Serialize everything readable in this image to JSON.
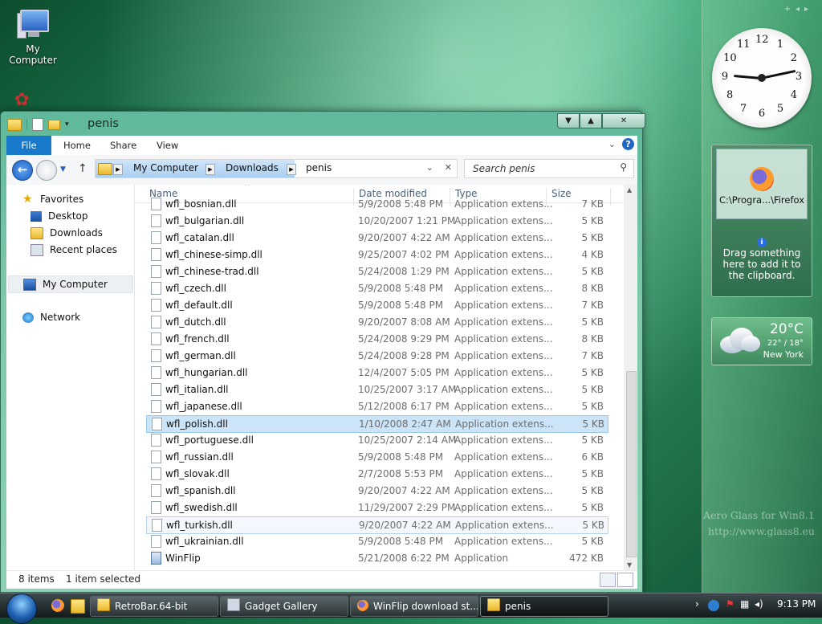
{
  "desktop": {
    "icon_label": "My Computer"
  },
  "clock": {
    "numbers": [
      "12",
      "1",
      "2",
      "3",
      "4",
      "5",
      "6",
      "7",
      "8",
      "9",
      "10",
      "11"
    ]
  },
  "clipboard_gadget": {
    "file_label": "C:\\Progra...\\Firefox",
    "hint": "Drag something here to add it to the clipboard."
  },
  "weather": {
    "temp": "20°C",
    "range": "22° / 18°",
    "city": "New York"
  },
  "watermark": {
    "line1": "Aero Glass for Win8.1",
    "line2": "http://www.glass8.eu"
  },
  "window": {
    "title": "penis",
    "ribbon_tabs": [
      "File",
      "Home",
      "Share",
      "View"
    ],
    "address": {
      "crumbs": [
        "My Computer",
        "Downloads",
        "penis"
      ]
    },
    "search": {
      "placeholder": "Search penis"
    },
    "nav": {
      "favorites": "Favorites",
      "desktop": "Desktop",
      "downloads": "Downloads",
      "recent": "Recent places",
      "my_computer": "My Computer",
      "network": "Network"
    },
    "columns": {
      "name": "Name",
      "date": "Date modified",
      "type": "Type",
      "size": "Size"
    },
    "files": [
      {
        "name": "wfl_bosnian.dll",
        "date": "5/9/2008 5:48 PM",
        "type": "Application extens...",
        "size": "7 KB"
      },
      {
        "name": "wfl_bulgarian.dll",
        "date": "10/20/2007 1:21 PM",
        "type": "Application extens...",
        "size": "5 KB"
      },
      {
        "name": "wfl_catalan.dll",
        "date": "9/20/2007 4:22 AM",
        "type": "Application extens...",
        "size": "5 KB"
      },
      {
        "name": "wfl_chinese-simp.dll",
        "date": "9/25/2007 4:02 PM",
        "type": "Application extens...",
        "size": "4 KB"
      },
      {
        "name": "wfl_chinese-trad.dll",
        "date": "5/24/2008 1:29 PM",
        "type": "Application extens...",
        "size": "5 KB"
      },
      {
        "name": "wfl_czech.dll",
        "date": "5/9/2008 5:48 PM",
        "type": "Application extens...",
        "size": "8 KB"
      },
      {
        "name": "wfl_default.dll",
        "date": "5/9/2008 5:48 PM",
        "type": "Application extens...",
        "size": "7 KB"
      },
      {
        "name": "wfl_dutch.dll",
        "date": "9/20/2007 8:08 AM",
        "type": "Application extens...",
        "size": "5 KB"
      },
      {
        "name": "wfl_french.dll",
        "date": "5/24/2008 9:29 PM",
        "type": "Application extens...",
        "size": "8 KB"
      },
      {
        "name": "wfl_german.dll",
        "date": "5/24/2008 9:28 PM",
        "type": "Application extens...",
        "size": "7 KB"
      },
      {
        "name": "wfl_hungarian.dll",
        "date": "12/4/2007 5:05 PM",
        "type": "Application extens...",
        "size": "5 KB"
      },
      {
        "name": "wfl_italian.dll",
        "date": "10/25/2007 3:17 AM",
        "type": "Application extens...",
        "size": "5 KB"
      },
      {
        "name": "wfl_japanese.dll",
        "date": "5/12/2008 6:17 PM",
        "type": "Application extens...",
        "size": "5 KB"
      },
      {
        "name": "wfl_polish.dll",
        "date": "1/10/2008 2:47 AM",
        "type": "Application extens...",
        "size": "5 KB"
      },
      {
        "name": "wfl_portuguese.dll",
        "date": "10/25/2007 2:14 AM",
        "type": "Application extens...",
        "size": "5 KB"
      },
      {
        "name": "wfl_russian.dll",
        "date": "5/9/2008 5:48 PM",
        "type": "Application extens...",
        "size": "6 KB"
      },
      {
        "name": "wfl_slovak.dll",
        "date": "2/7/2008 5:53 PM",
        "type": "Application extens...",
        "size": "5 KB"
      },
      {
        "name": "wfl_spanish.dll",
        "date": "9/20/2007 4:22 AM",
        "type": "Application extens...",
        "size": "5 KB"
      },
      {
        "name": "wfl_swedish.dll",
        "date": "11/29/2007 2:29 PM",
        "type": "Application extens...",
        "size": "5 KB"
      },
      {
        "name": "wfl_turkish.dll",
        "date": "9/20/2007 4:22 AM",
        "type": "Application extens...",
        "size": "5 KB"
      },
      {
        "name": "wfl_ukrainian.dll",
        "date": "5/9/2008 5:48 PM",
        "type": "Application extens...",
        "size": "5 KB"
      },
      {
        "name": "WinFlip",
        "date": "5/21/2008 6:22 PM",
        "type": "Application",
        "size": "472 KB"
      }
    ],
    "selected_file": "wfl_polish.dll",
    "hovered_file": "wfl_turkish.dll",
    "status": {
      "items": "8 items",
      "selected": "1 item selected"
    }
  },
  "taskbar": {
    "buttons": [
      {
        "label": "RetroBar.64-bit"
      },
      {
        "label": "Gadget Gallery"
      },
      {
        "label": "WinFlip download st..."
      },
      {
        "label": "penis"
      }
    ],
    "time": "9:13 PM"
  },
  "colors": {
    "file_tab": "#1979ca",
    "selection": "#cce4f7",
    "window_frame": "#7ec8ab"
  }
}
